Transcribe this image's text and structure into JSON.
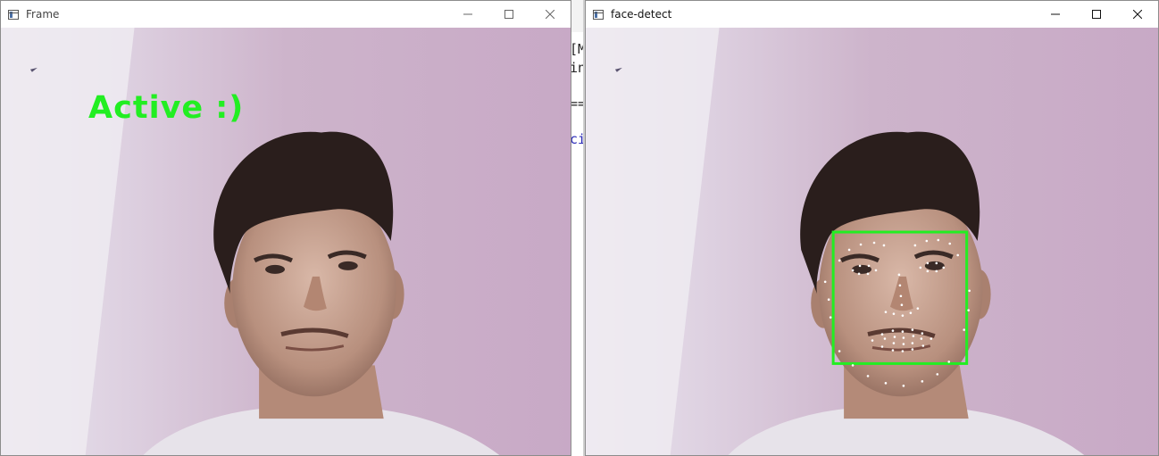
{
  "background_terminal": {
    "lines": [
      "[M",
      "in",
      "==",
      "ci"
    ]
  },
  "windows": [
    {
      "title": "Frame",
      "overlay_text": "Active :)",
      "overlay_color": "#22ee22",
      "controls": [
        "minimize",
        "maximize",
        "close"
      ]
    },
    {
      "title": "face-detect",
      "box_color": "#22ee22",
      "landmark_color": "#ffffff",
      "controls": [
        "minimize",
        "maximize",
        "close"
      ]
    }
  ],
  "icons": {
    "window_icon": "app-window-icon",
    "minimize": "minimize-icon",
    "maximize": "maximize-icon",
    "close": "close-icon"
  }
}
